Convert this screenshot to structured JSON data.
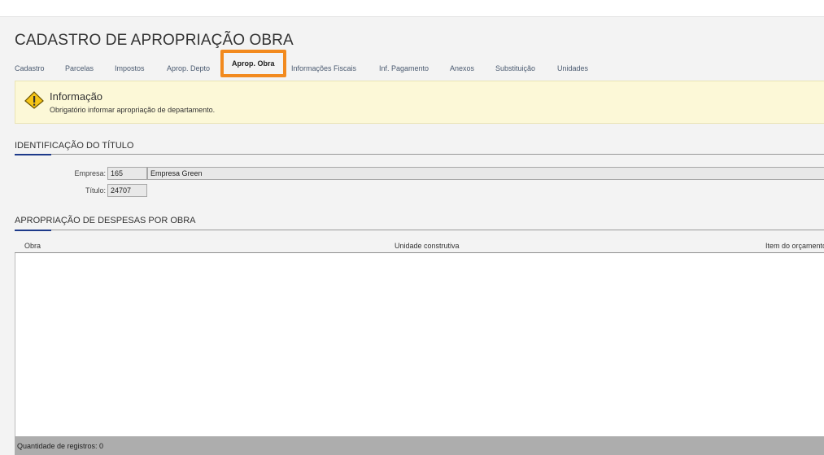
{
  "page": {
    "title": "CADASTRO DE APROPRIAÇÃO OBRA"
  },
  "tabs": [
    {
      "label": "Cadastro"
    },
    {
      "label": "Parcelas"
    },
    {
      "label": "Impostos"
    },
    {
      "label": "Aprop. Depto"
    },
    {
      "label": "Aprop. Obra",
      "active": true
    },
    {
      "label": "Informações Fiscais"
    },
    {
      "label": "Inf. Pagamento"
    },
    {
      "label": "Anexos"
    },
    {
      "label": "Substituição"
    },
    {
      "label": "Unidades"
    }
  ],
  "info": {
    "icon": "warning-icon",
    "title": "Informação",
    "message": "Obrigatório informar apropriação de departamento."
  },
  "identificacao": {
    "title": "IDENTIFICAÇÃO DO TÍTULO",
    "empresa_label": "Empresa:",
    "empresa_code": "165",
    "empresa_name": "Empresa Green",
    "titulo_label": "Título:",
    "titulo_value": "24707"
  },
  "apropriacao": {
    "title": "APROPRIAÇÃO DE DESPESAS POR OBRA",
    "columns": [
      "Obra",
      "Unidade construtiva",
      "Item do orçamento"
    ],
    "rows": [],
    "footer": "Quantidade de registros: 0"
  },
  "colors": {
    "accent_active_tab": "#f28a1e",
    "section_accent": "#1d3a8a",
    "info_background": "#fcf8d7",
    "warning_icon": "#f5c518"
  }
}
